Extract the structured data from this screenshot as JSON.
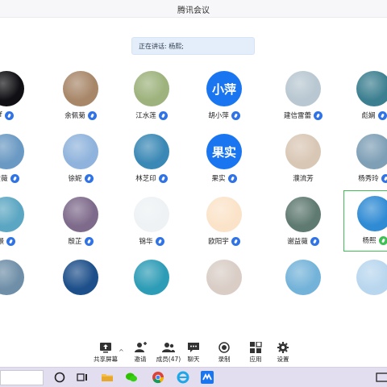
{
  "window": {
    "title": "腾讯会议"
  },
  "speaking": {
    "text": "正在讲话: 杨熙;"
  },
  "colors": {
    "accent": "#1a76f0",
    "mic": "#2f73e6",
    "active": "#3fbf55",
    "taskbar": "#e3ddf0"
  },
  "participants": [
    {
      "name": "f",
      "avatar": "photo",
      "bg": "#101014",
      "mic": "blue"
    },
    {
      "name": "余佩菊",
      "avatar": "photo",
      "bg": "#a88769",
      "mic": "blue"
    },
    {
      "name": "江水莲",
      "avatar": "photo",
      "bg": "#9db27c",
      "mic": "blue"
    },
    {
      "name": "胡小萍",
      "avatar": "text",
      "avatar_text": "小萍",
      "mic": "blue"
    },
    {
      "name": "建信雷蕾",
      "avatar": "photo",
      "bg": "#b8c7d1",
      "mic": "blue"
    },
    {
      "name": "彪娴",
      "avatar": "photo",
      "bg": "#3c7f90",
      "mic": "blue"
    },
    {
      "name": "黄薇",
      "avatar": "photo",
      "bg": "#6a99c3",
      "mic": "blue"
    },
    {
      "name": "徐妮",
      "avatar": "photo",
      "bg": "#8fb3dc",
      "mic": "blue"
    },
    {
      "name": "林芝印",
      "avatar": "photo",
      "bg": "#3a88b5",
      "mic": "blue"
    },
    {
      "name": "果实",
      "avatar": "text",
      "avatar_text": "果实",
      "mic": "blue"
    },
    {
      "name": "濮流芳",
      "avatar": "photo",
      "bg": "#d9c7b5",
      "mic": "none"
    },
    {
      "name": "杨秀玲",
      "avatar": "photo",
      "bg": "#7e9fb6",
      "mic": "blue"
    },
    {
      "name": "景",
      "avatar": "photo",
      "bg": "#5ba6c2",
      "mic": "blue"
    },
    {
      "name": "殷芷",
      "avatar": "photo",
      "bg": "#7e6a8b",
      "mic": "blue"
    },
    {
      "name": "锦华",
      "avatar": "photo",
      "bg": "#eef2f4",
      "mic": "blue"
    },
    {
      "name": "欧阳宇",
      "avatar": "photo",
      "bg": "#fbe3c9",
      "mic": "blue"
    },
    {
      "name": "谢益薇",
      "avatar": "photo",
      "bg": "#5f7a70",
      "mic": "blue"
    },
    {
      "name": "杨熙",
      "avatar": "photo",
      "bg": "#2f8bd4",
      "mic": "green",
      "active": true
    },
    {
      "name": "",
      "avatar": "photo",
      "bg": "#6f8fa8",
      "mic": "none"
    },
    {
      "name": "",
      "avatar": "photo",
      "bg": "#1d4f8a",
      "mic": "none"
    },
    {
      "name": "",
      "avatar": "photo",
      "bg": "#2d9cb6",
      "mic": "none"
    },
    {
      "name": "",
      "avatar": "photo",
      "bg": "#d9cdc6",
      "mic": "none"
    },
    {
      "name": "",
      "avatar": "photo",
      "bg": "#74b3d9",
      "mic": "none"
    },
    {
      "name": "",
      "avatar": "photo",
      "bg": "#b8d6ee",
      "mic": "none"
    }
  ],
  "toolbar": {
    "share_label": "共享屏幕",
    "invite_label": "邀请",
    "members_label": "成员(47)",
    "chat_label": "聊天",
    "record_label": "录制",
    "apps_label": "应用",
    "settings_label": "设置"
  },
  "taskbar": {
    "icons": [
      "cortana-icon",
      "task-view-icon",
      "file-explorer-icon",
      "wechat-icon",
      "chrome-icon",
      "ie-icon",
      "tencent-meeting-icon"
    ]
  }
}
